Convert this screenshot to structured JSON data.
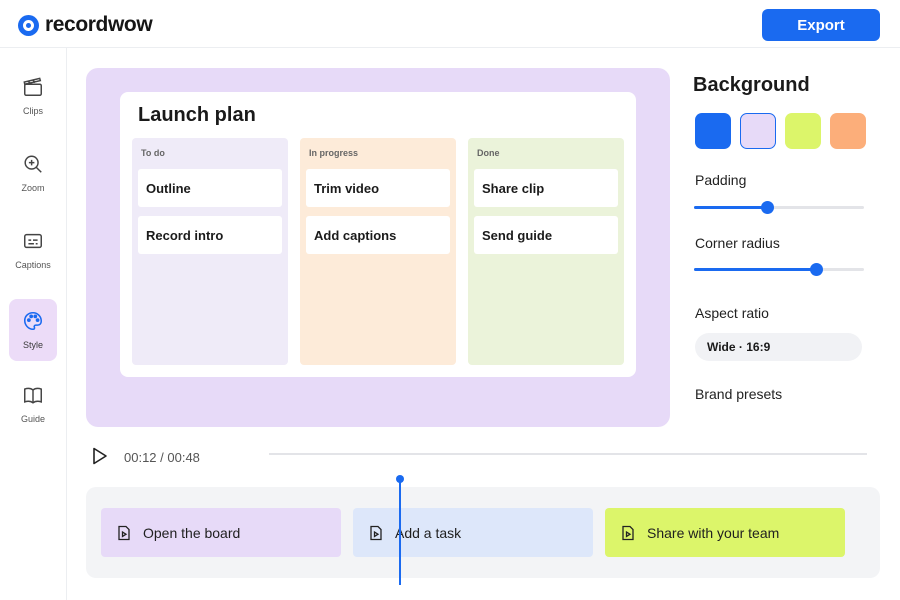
{
  "app": {
    "name": "recordwow"
  },
  "header": {
    "export_label": "Export"
  },
  "sidebar": {
    "items": [
      {
        "label": "Clips",
        "icon": "clapperboard-icon",
        "active": false
      },
      {
        "label": "Zoom",
        "icon": "zoom-icon",
        "active": false
      },
      {
        "label": "Captions",
        "icon": "captions-icon",
        "active": false
      },
      {
        "label": "Style",
        "icon": "palette-icon",
        "active": true
      },
      {
        "label": "Guide",
        "icon": "book-icon",
        "active": false
      }
    ]
  },
  "board": {
    "title": "Launch plan",
    "columns": [
      {
        "title": "To do",
        "color": "#efebf8",
        "cards": [
          "Outline",
          "Record intro"
        ]
      },
      {
        "title": "In progress",
        "color": "#fdebd9",
        "cards": [
          "Trim video",
          "Add captions"
        ]
      },
      {
        "title": "Done",
        "color": "#ebf3da",
        "cards": [
          "Share clip",
          "Send guide"
        ]
      }
    ]
  },
  "panel": {
    "background_title": "Background",
    "swatches": [
      {
        "name": "blue",
        "color": "#1a6af0",
        "selected": false
      },
      {
        "name": "lavender",
        "color": "#e7daf8",
        "selected": true
      },
      {
        "name": "lime",
        "color": "#dcf56a",
        "selected": false
      },
      {
        "name": "peach",
        "color": "#fcae7a",
        "selected": false
      }
    ],
    "padding_label": "Padding",
    "padding_level": 0.43,
    "corner_radius_label": "Corner radius",
    "corner_radius_level": 0.72,
    "aspect_label": "Aspect ratio",
    "aspect_value": "Wide · 16:9",
    "brand_presets_label": "Brand presets"
  },
  "playback": {
    "timecode": "00:12 / 00:48"
  },
  "timeline": {
    "clips": [
      {
        "label": "Open the board",
        "color": "#e7daf8"
      },
      {
        "label": "Add a task",
        "color": "#dde7fa"
      },
      {
        "label": "Share with your team",
        "color": "#dcf56a"
      }
    ]
  },
  "colors": {
    "accent": "#1a6af0",
    "canvas_bg": "#e7daf8",
    "active_nav": "#ecdcf8"
  }
}
